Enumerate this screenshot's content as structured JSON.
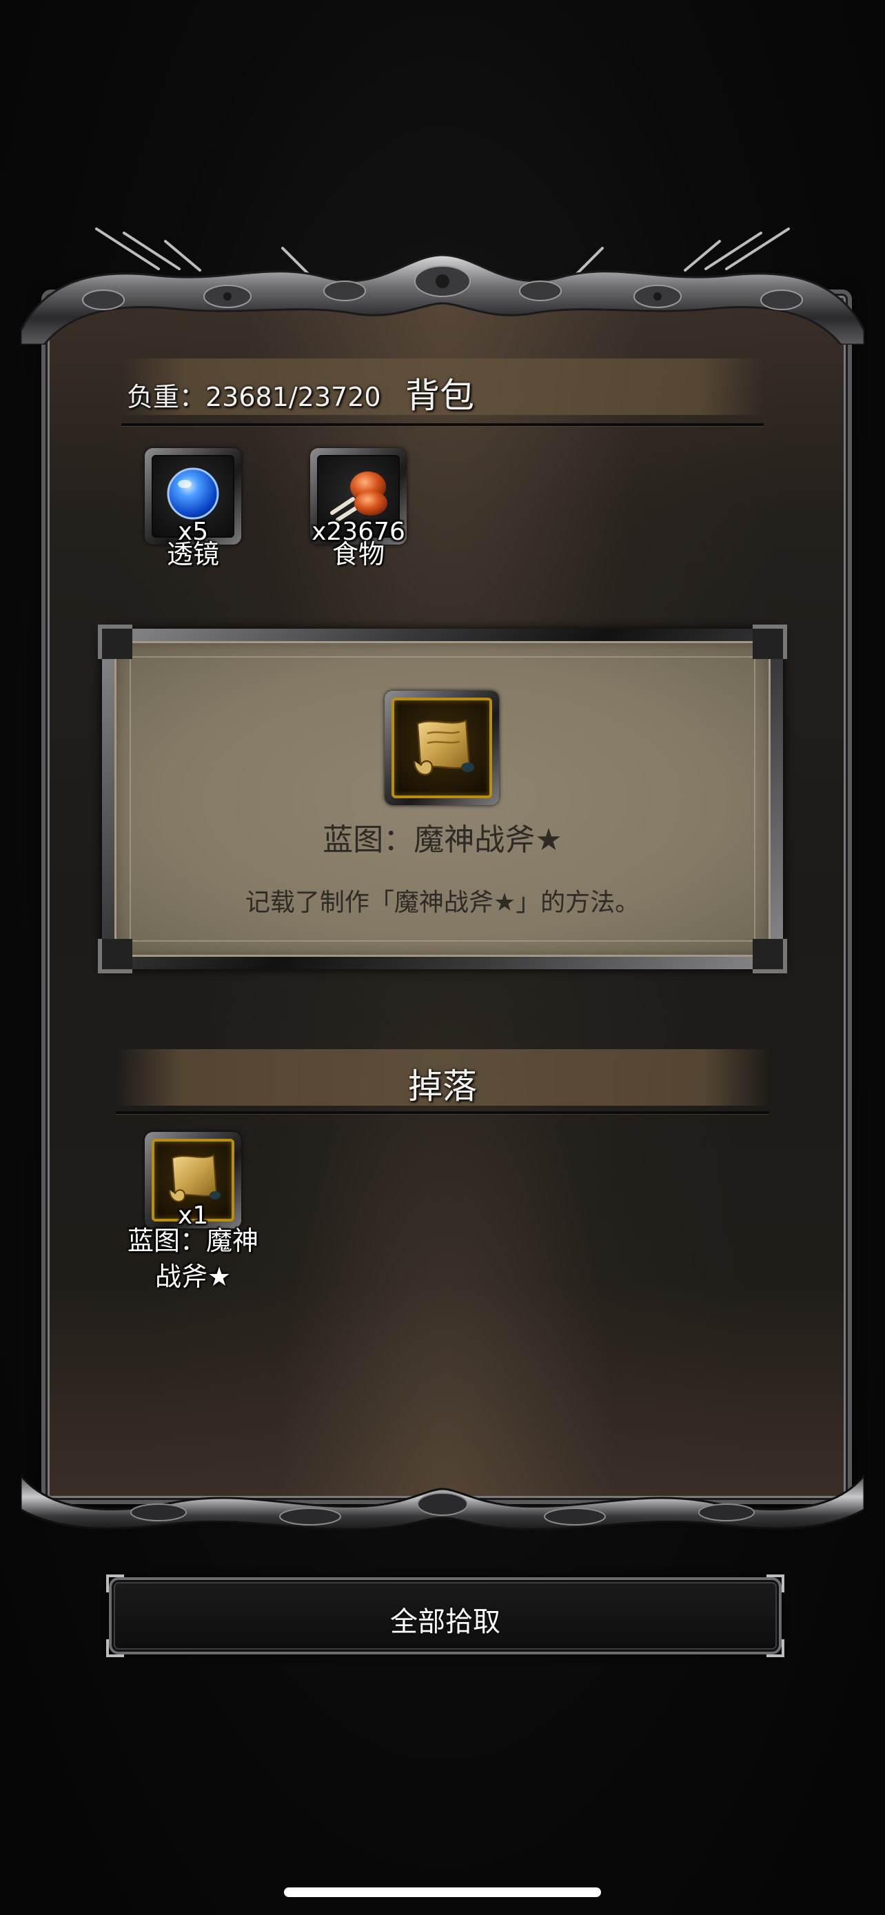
{
  "backpack": {
    "weight_text": "负重：23681/23720",
    "title": "背包",
    "items": [
      {
        "icon": "lens-icon",
        "count": "x5",
        "name": "透镜"
      },
      {
        "icon": "food-icon",
        "count": "x23676",
        "name": "食物"
      }
    ]
  },
  "detail": {
    "icon": "blueprint-scroll-icon",
    "title": "蓝图：魔神战斧★",
    "description": "记载了制作「魔神战斧★」的方法。"
  },
  "drops": {
    "title": "掉落",
    "items": [
      {
        "icon": "blueprint-scroll-icon",
        "count": "x1",
        "name_line1": "蓝图：魔神",
        "name_line2": "战斧★"
      }
    ]
  },
  "actions": {
    "collect_all_label": "全部拾取"
  },
  "colors": {
    "gold_border": "#b98f13",
    "card_face": "#8e8470",
    "panel_bg": "#1c1b19"
  }
}
